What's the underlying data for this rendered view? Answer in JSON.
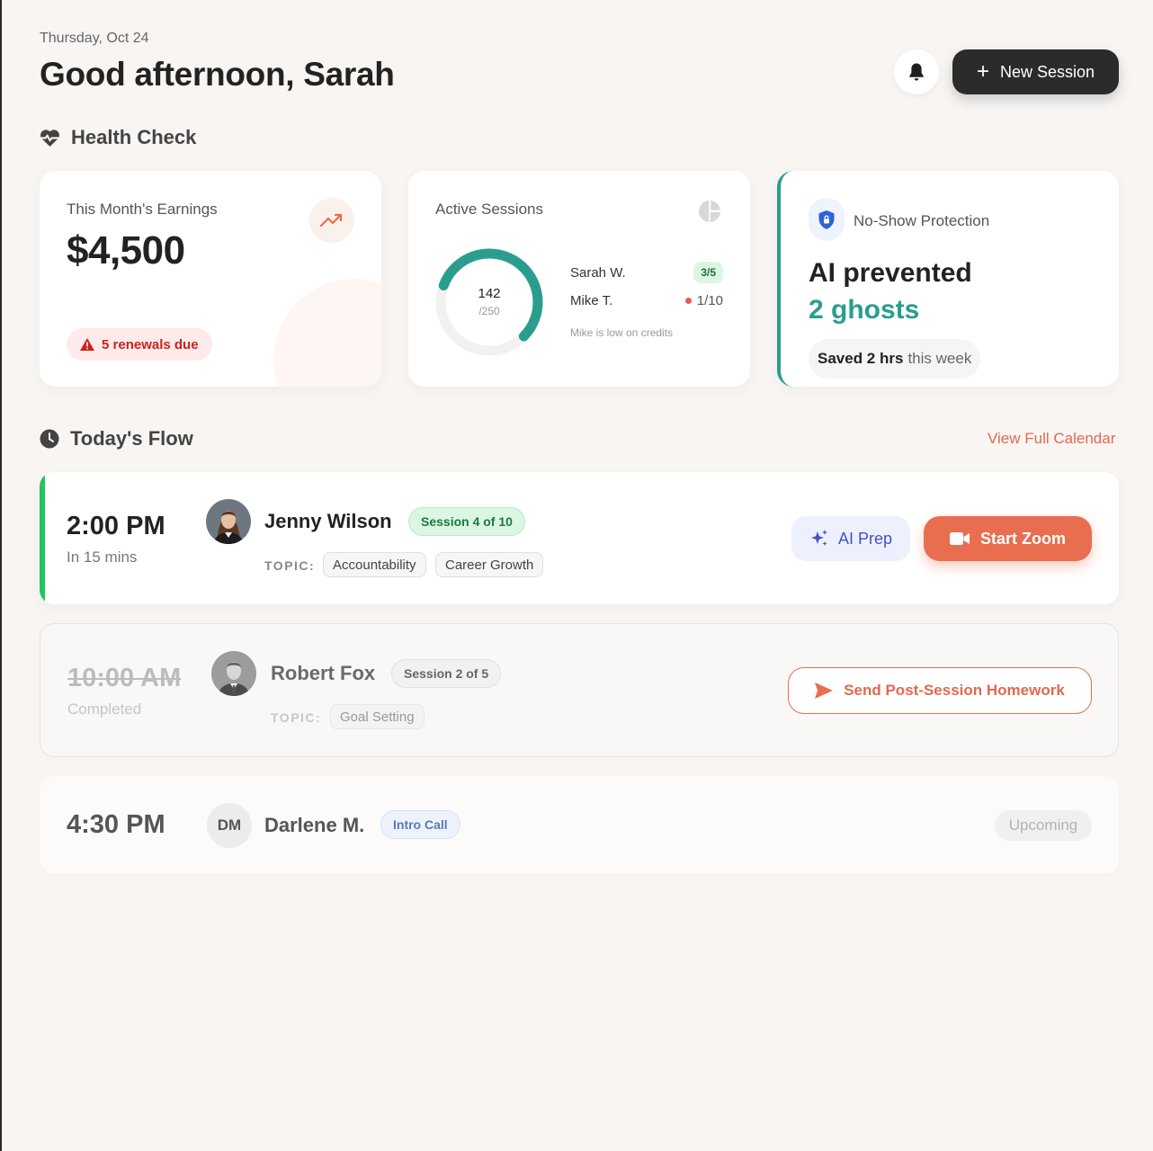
{
  "header": {
    "date": "Thursday, Oct 24",
    "greeting": "Good afternoon, Sarah",
    "new_session_label": "New Session"
  },
  "health": {
    "title": "Health Check",
    "earnings": {
      "label": "This Month's Earnings",
      "amount": "$4,500",
      "renewals": "5 renewals due"
    },
    "sessions": {
      "label": "Active Sessions",
      "used": "142",
      "total": "/250",
      "progress": 0.568,
      "clients": [
        {
          "name": "Sarah W.",
          "credits": "3/5"
        },
        {
          "name": "Mike T.",
          "credits": "1/10"
        }
      ],
      "note": "Mike is low on credits"
    },
    "protection": {
      "label": "No-Show Protection",
      "line1": "AI prevented",
      "line2": "2 ghosts",
      "saved_bold": "Saved 2 hrs",
      "saved_rest": "this week"
    }
  },
  "flow": {
    "title": "Today's Flow",
    "view_calendar": "View Full Calendar",
    "topic_label": "TOPIC:",
    "items": [
      {
        "time": "2:00 PM",
        "subtime": "In 15 mins",
        "name": "Jenny Wilson",
        "badge": "Session 4 of 10",
        "tags": [
          "Accountability",
          "Career Growth"
        ],
        "ai_prep": "AI Prep",
        "start_zoom": "Start Zoom"
      },
      {
        "time": "10:00 AM",
        "subtime": "Completed",
        "name": "Robert Fox",
        "badge": "Session 2 of 5",
        "tags": [
          "Goal Setting"
        ],
        "action": "Send Post-Session Homework"
      },
      {
        "time": "4:30 PM",
        "initials": "DM",
        "name": "Darlene M.",
        "badge": "Intro Call",
        "status": "Upcoming"
      }
    ]
  },
  "colors": {
    "accent": "#e86e4f",
    "teal": "#2a9d8f",
    "success": "#22c55e",
    "background": "#f8f5f3"
  },
  "icons": [
    "bell-icon",
    "plus-icon",
    "heartbeat-icon",
    "trend-up-icon",
    "warning-icon",
    "pie-chart-icon",
    "shield-lock-icon",
    "clock-icon",
    "sparkles-icon",
    "video-camera-icon",
    "send-icon"
  ]
}
